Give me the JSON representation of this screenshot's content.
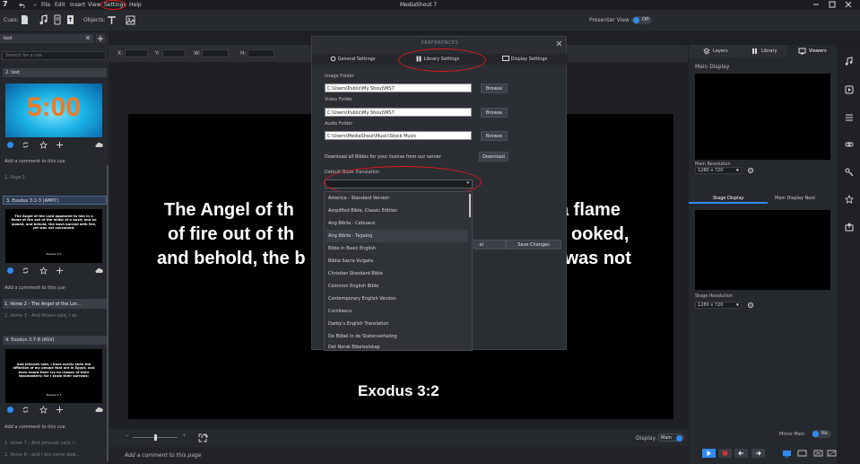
{
  "app": {
    "title": "MediaShout 7",
    "menu": [
      "File",
      "Edit",
      "Insert",
      "View",
      "Settings",
      "Help"
    ]
  },
  "toolbar": {
    "cues_label": "Cues:",
    "objects_label": "Objects:",
    "presenter_view_label": "Presenter View :",
    "presenter_view_state": "Off"
  },
  "left": {
    "tab_name": "test",
    "search_placeholder": "Search for a cue",
    "cues": [
      {
        "header": "2. test",
        "thumb_text": "5:00",
        "comment": "Add a comment to this cue",
        "items": [
          "1. Page 1"
        ]
      },
      {
        "header": "3. Exodus 3:2-3 (AMPC)",
        "thumb_text": "The Angel of the Lord appeared to him in a flame of fire out of the midst of a bush; and he looked, and behold, the bush burned with fire, yet was not consumed.",
        "thumb_ref": "Exodus 3:2",
        "comment": "Add a comment to this cue",
        "items": [
          "1. Verse 2 - The Angel of the Lor...",
          "2. Verse 3 - And Moses said, I wi..."
        ]
      },
      {
        "header": "4. Exodus 3:7-8 (ASV)",
        "thumb_text": "And Jehovah said, I have surely seen the affliction of my people that are in Egypt, and have heard their cry by reason of their taskmasters; for I know their sorrows;",
        "thumb_ref": "Exodus 3:7",
        "comment": "Add a comment to this cue",
        "items": [
          "1. Verse 7 - And Jehovah said, I...",
          "2. Verse 8 - and I am come dow..."
        ]
      }
    ]
  },
  "center": {
    "fields": [
      "X:",
      "Y:",
      "W:",
      "H:"
    ],
    "stage_lines": [
      "The Angel of th",
      "a flame",
      "of fire out of th",
      "ooked,",
      "and behold, the b",
      "n fire, yet was not"
    ],
    "stage_ref": "Exodus 3:2",
    "display_label": "Display",
    "display_value": "Main",
    "comment_placeholder": "Add a comment to this page"
  },
  "right": {
    "tabs": [
      "Layers",
      "Library",
      "Viewers"
    ],
    "main_display": "Main Display",
    "main_resolution_label": "Main Resolution",
    "main_resolution": "1280 x 720",
    "stage_tabs": [
      "Stage Display",
      "Main Display Next"
    ],
    "stage_resolution_label": "Stage Resolution",
    "stage_resolution": "1280 x 720",
    "mirror_label": "Mirror Main",
    "mirror_state": "No"
  },
  "dialog": {
    "title": "PREFERENCES",
    "tabs": [
      "General Settings",
      "Library Settings",
      "Display Settings"
    ],
    "image_folder_label": "Image Folder",
    "image_folder": "C:\\Users\\Public\\My Shout\\MS7",
    "video_folder_label": "Video Folder",
    "video_folder": "C:\\Users\\Public\\My Shout\\MS7",
    "audio_folder_label": "Audio Folder",
    "audio_folder": "C:\\Users\\MediaShout\\Music\\Stock Music",
    "browse": "Browse",
    "download_text": "Download all Bibles for your license from our server",
    "download_btn": "Download",
    "bible_label": "Default Bible Translation",
    "cancel_btn": "el",
    "save_btn": "Save Changes"
  },
  "dropdown": {
    "options": [
      "America - Standard Version",
      "Amplified Bible, Classic Edition",
      "Ang Biblia - Cebuano",
      "Ang Biblia - Tagalog",
      "Bible in Basic English",
      "Biblia Sacra Vulgata",
      "Christian Standard Bible",
      "Common English Bible",
      "Contemporary English Version",
      "Cornilescu",
      "Darby's English Translation",
      "De Bijbel in de Statenvertaling",
      "Det Norsk Bibelselskap"
    ]
  },
  "colors": {
    "accent": "#2f8cf0",
    "annotation_red": "#e01919",
    "stop_red": "#d9312f"
  }
}
